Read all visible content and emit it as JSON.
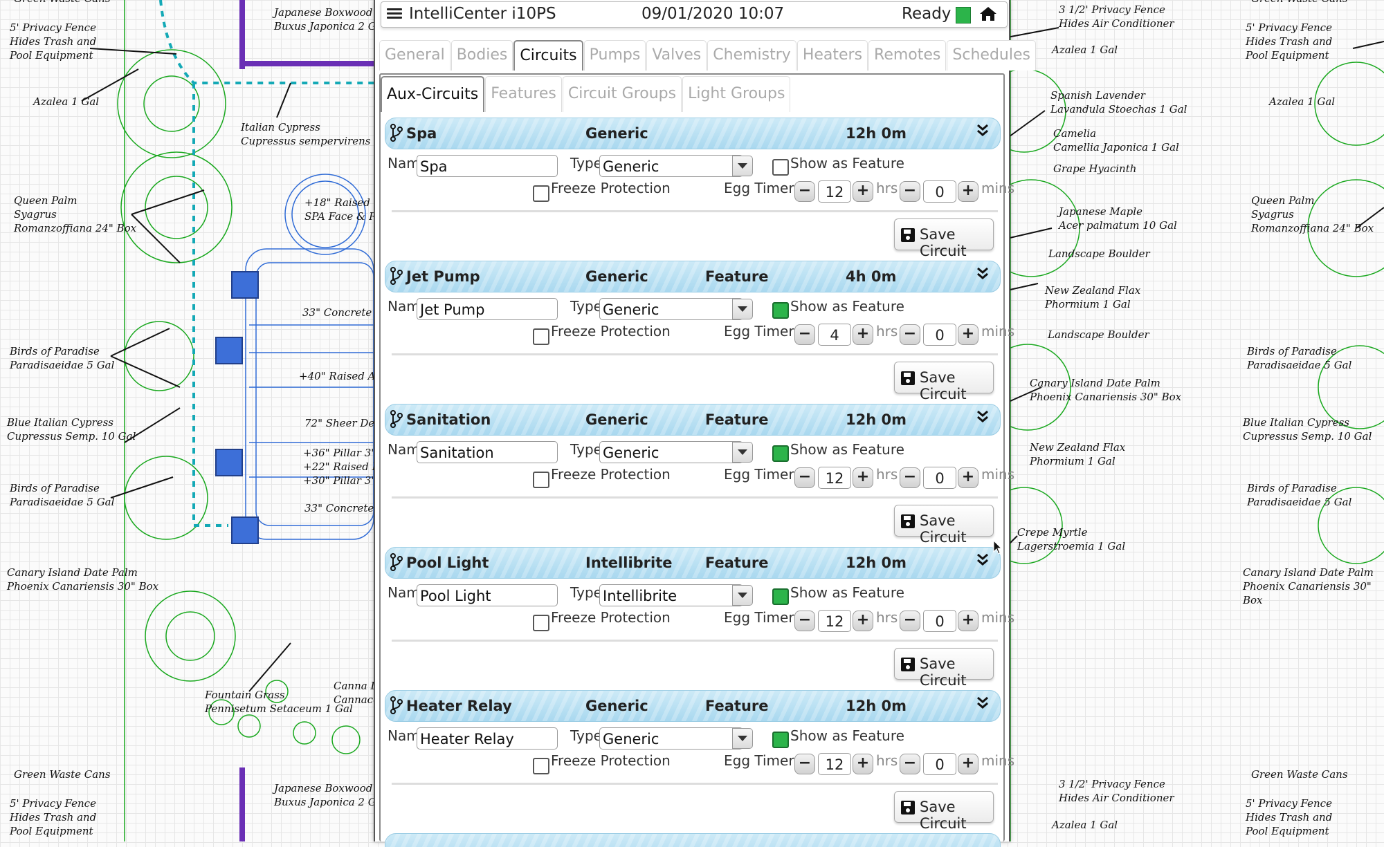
{
  "header": {
    "title": "IntelliCenter i10PS",
    "datetime": "09/01/2020 10:07",
    "status": "Ready"
  },
  "colors": {
    "accent": "#a9d8ef",
    "status_ok": "#2cb44a",
    "tab_inactive": "#aaaaaa"
  },
  "tabs": [
    {
      "label": "General",
      "active": false
    },
    {
      "label": "Bodies",
      "active": false
    },
    {
      "label": "Circuits",
      "active": true
    },
    {
      "label": "Pumps",
      "active": false
    },
    {
      "label": "Valves",
      "active": false
    },
    {
      "label": "Chemistry",
      "active": false
    },
    {
      "label": "Heaters",
      "active": false
    },
    {
      "label": "Remotes",
      "active": false
    },
    {
      "label": "Schedules",
      "active": false
    }
  ],
  "subtabs": [
    {
      "label": "Aux-Circuits",
      "active": true
    },
    {
      "label": "Features",
      "active": false
    },
    {
      "label": "Circuit Groups",
      "active": false
    },
    {
      "label": "Light Groups",
      "active": false
    }
  ],
  "labels": {
    "name": "Name",
    "type": "Type",
    "show_feature": "Show as Feature",
    "freeze": "Freeze Protection",
    "egg_timer": "Egg Timer",
    "hrs": "hrs",
    "mins": "mins",
    "save": "Save Circuit",
    "minus": "−",
    "plus": "+"
  },
  "circuits": [
    {
      "name": "Spa",
      "type": "Generic",
      "feature": "",
      "time": "12h 0m",
      "show_as_feature": false,
      "freeze": false,
      "hours": "12",
      "mins": "0"
    },
    {
      "name": "Jet Pump",
      "type": "Generic",
      "feature": "Feature",
      "time": "4h 0m",
      "show_as_feature": true,
      "freeze": false,
      "hours": "4",
      "mins": "0"
    },
    {
      "name": "Sanitation",
      "type": "Generic",
      "feature": "Feature",
      "time": "12h 0m",
      "show_as_feature": true,
      "freeze": false,
      "hours": "12",
      "mins": "0"
    },
    {
      "name": "Pool Light",
      "type": "Intellibrite",
      "feature": "Feature",
      "time": "12h 0m",
      "show_as_feature": true,
      "freeze": false,
      "hours": "12",
      "mins": "0"
    },
    {
      "name": "Heater Relay",
      "type": "Generic",
      "feature": "Feature",
      "time": "12h 0m",
      "show_as_feature": true,
      "freeze": false,
      "hours": "12",
      "mins": "0"
    }
  ],
  "background_labels": [
    "Green Waste Cans",
    "5' Privacy Fence\nHides Trash and\nPool Equipment",
    "Azalea 1 Gal",
    "Queen Palm\nSyagrus\nRomanzoffiana 24\" Box",
    "Birds of Paradise\nParadisaeidae 5 Gal",
    "Blue Italian Cypress\nCupressus Semp. 10 Gal",
    "Birds of Paradise\nParadisaeidae 5 Gal",
    "Canary Island Date Palm\nPhoenix Canariensis 30\" Box",
    "Green Waste Cans",
    "5' Privacy Fence\nHides Trash and\nPool Equipment",
    "Japanese Boxwood H\nBuxus Japonica 2 G",
    "Italian Cypress\nCupressus sempervirens 10",
    "Fountain Grass\nPennisetum Setaceum 1 Gal",
    "Canna Li\nCannace",
    "Japanese Boxwood H\nBuxus Japonica 2 G",
    "+18\" Raised SP\nSPA Face & Rd",
    "33\" Concrete Fi",
    "+40\" Raised Arc",
    "72\" Sheer Des",
    "+36\" Pillar 3'x3\n+22\" Raised Bo\n+30\" Pillar 3'x3",
    "33\" Concrete F",
    "3 1/2' Privacy Fence\nHides Air Conditioner",
    "Azalea 1 Gal",
    "Spanish Lavender\nLavandula Stoechas 1 Gal",
    "Camelia\nCamellia Japonica 1 Gal",
    "Grape Hyacinth",
    "Japanese Maple\nAcer palmatum 10 Gal",
    "Landscape Boulder",
    "New Zealand Flax\nPhormium 1 Gal",
    "Landscape Boulder",
    "Canary Island Date Palm\nPhoenix Canariensis 30\" Box",
    "New Zealand Flax\nPhormium 1 Gal",
    "Crepe Myrtle\nLagerstroemia 1 Gal",
    "3 1/2' Privacy Fence\nHides Air Conditioner",
    "Azalea 1 Gal",
    "Green Waste Cans",
    "5' Privacy Fence\nHides Trash and\nPool Equipment",
    "Azalea 1 Gal",
    "Queen Palm\nSyagrus\nRomanzoffiana 24\" Box",
    "Birds of Paradise\nParadisaeidae 5 Gal",
    "Blue Italian Cypress\nCupressus Semp. 10 Gal",
    "Birds of Paradise\nParadisaeidae 5 Gal",
    "Canary Island Date Palm\nPhoenix Canariensis 30\" Box",
    "Green Waste Cans",
    "5' Privacy Fence\nHides Trash and\nPool Equipment"
  ]
}
